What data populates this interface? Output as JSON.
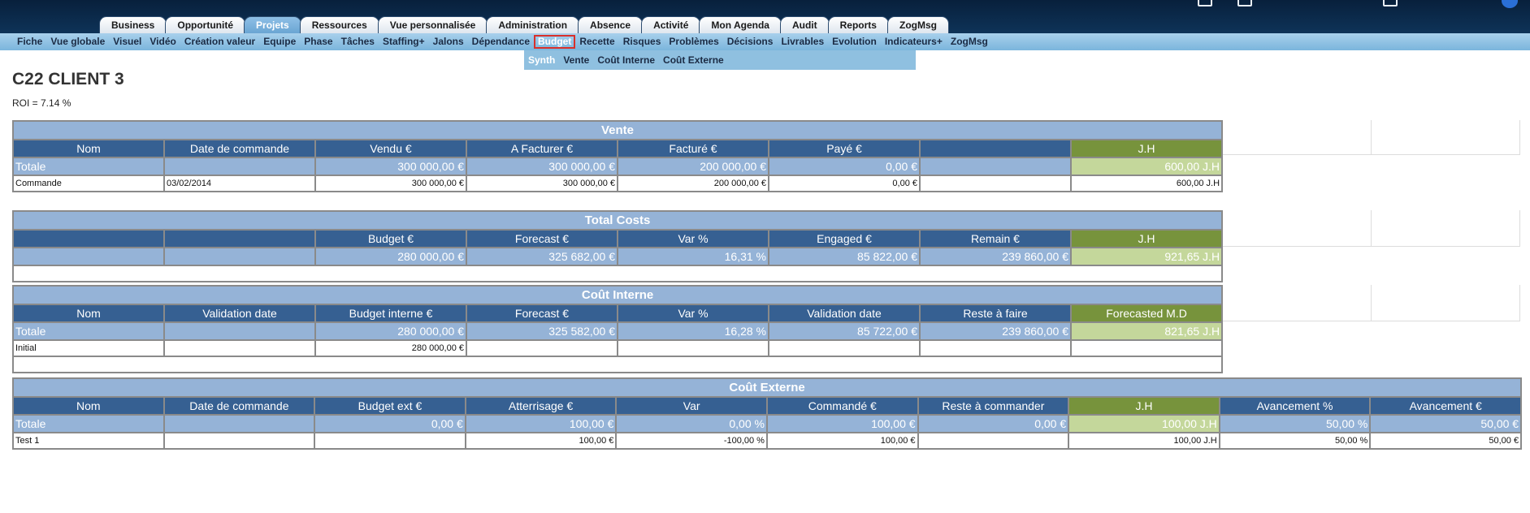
{
  "tabs": [
    {
      "label": "Business",
      "active": false
    },
    {
      "label": "Opportunité",
      "active": false
    },
    {
      "label": "Projets",
      "active": true
    },
    {
      "label": "Ressources",
      "active": false
    },
    {
      "label": "Vue personnalisée",
      "active": false
    },
    {
      "label": "Administration",
      "active": false
    },
    {
      "label": "Absence",
      "active": false
    },
    {
      "label": "Activité",
      "active": false
    },
    {
      "label": "Mon Agenda",
      "active": false
    },
    {
      "label": "Audit",
      "active": false
    },
    {
      "label": "Reports",
      "active": false
    },
    {
      "label": "ZogMsg",
      "active": false
    }
  ],
  "submenu": [
    {
      "label": "Fiche"
    },
    {
      "label": "Vue globale"
    },
    {
      "label": "Visuel"
    },
    {
      "label": "Vidéo"
    },
    {
      "label": "Création valeur"
    },
    {
      "label": "Equipe"
    },
    {
      "label": "Phase"
    },
    {
      "label": "Tâches"
    },
    {
      "label": "Staffing+"
    },
    {
      "label": "Jalons"
    },
    {
      "label": "Dépendance"
    },
    {
      "label": "Budget",
      "active": true
    },
    {
      "label": "Recette"
    },
    {
      "label": "Risques"
    },
    {
      "label": "Problèmes"
    },
    {
      "label": "Décisions"
    },
    {
      "label": "Livrables"
    },
    {
      "label": "Evolution"
    },
    {
      "label": "Indicateurs+"
    },
    {
      "label": "ZogMsg"
    }
  ],
  "budget_submenu": [
    {
      "label": "Synth",
      "active": true
    },
    {
      "label": "Vente"
    },
    {
      "label": "Coût Interne"
    },
    {
      "label": "Coût Externe"
    }
  ],
  "page": {
    "title": "C22 CLIENT 3",
    "roi": "ROI = 7.14 %"
  },
  "vente": {
    "title": "Vente",
    "headers": [
      "Nom",
      "Date de commande",
      "Vendu €",
      "A Facturer €",
      "Facturé €",
      "Payé €",
      "",
      "J.H"
    ],
    "total": [
      "Totale",
      "",
      "300 000,00 €",
      "300 000,00 €",
      "200 000,00 €",
      "0,00 €",
      "",
      "600,00 J.H"
    ],
    "rows": [
      [
        "Commande",
        "03/02/2014",
        "300 000,00 €",
        "300 000,00 €",
        "200 000,00 €",
        "0,00 €",
        "",
        "600,00 J.H"
      ]
    ]
  },
  "total_costs": {
    "title": "Total Costs",
    "headers": [
      "",
      "",
      "Budget €",
      "Forecast €",
      "Var %",
      "Engaged €",
      "Remain €",
      "J.H"
    ],
    "total": [
      "",
      "",
      "280 000,00 €",
      "325 682,00 €",
      "16,31 %",
      "85 822,00 €",
      "239 860,00 €",
      "921,65 J.H"
    ]
  },
  "cout_interne": {
    "title": "Coût Interne",
    "headers": [
      "Nom",
      "Validation date",
      "Budget interne €",
      "Forecast €",
      "Var %",
      "Validation date",
      "Reste à faire",
      "Forecasted M.D"
    ],
    "total": [
      "Totale",
      "",
      "280 000,00 €",
      "325 582,00 €",
      "16,28 %",
      "85 722,00 €",
      "239 860,00 €",
      "821,65 J.H"
    ],
    "rows": [
      [
        "Initial",
        "",
        "280 000,00 €",
        "",
        "",
        "",
        "",
        ""
      ]
    ]
  },
  "cout_externe": {
    "title": "Coût Externe",
    "headers": [
      "Nom",
      "Date de commande",
      "Budget ext €",
      "Atterrisage €",
      "Var",
      "Commandé €",
      "Reste à commander",
      "J.H",
      "Avancement %",
      "Avancement €"
    ],
    "total": [
      "Totale",
      "",
      "0,00 €",
      "100,00 €",
      "0,00 %",
      "100,00 €",
      "0,00 €",
      "100,00 J.H",
      "50,00 %",
      "50,00 €"
    ],
    "rows": [
      [
        "Test 1",
        "",
        "",
        "100,00 €",
        "-100,00 %",
        "100,00 €",
        "",
        "100,00 J.H",
        "50,00 %",
        "50,00 €"
      ]
    ]
  }
}
